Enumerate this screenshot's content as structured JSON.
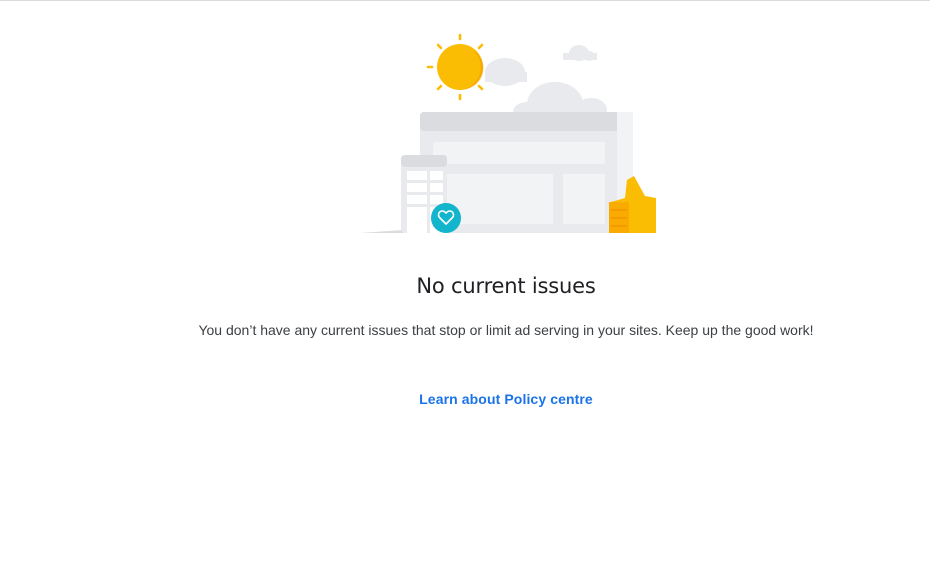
{
  "empty_state": {
    "title": "No current issues",
    "message": "You don’t have any current issues that stop or limit ad serving in your sites. Keep up the good work!",
    "link_label": "Learn about Policy centre"
  },
  "illustration": {
    "icons": [
      "sun-icon",
      "cloud-icon",
      "browser-window-icon",
      "mobile-phone-icon",
      "heart-badge-icon",
      "thumbs-up-icon"
    ]
  },
  "colors": {
    "link": "#1a73e8",
    "sun": "#fbbc04",
    "heart_badge": "#12b5cb",
    "title_text": "#202124",
    "body_text": "#3c4043"
  }
}
